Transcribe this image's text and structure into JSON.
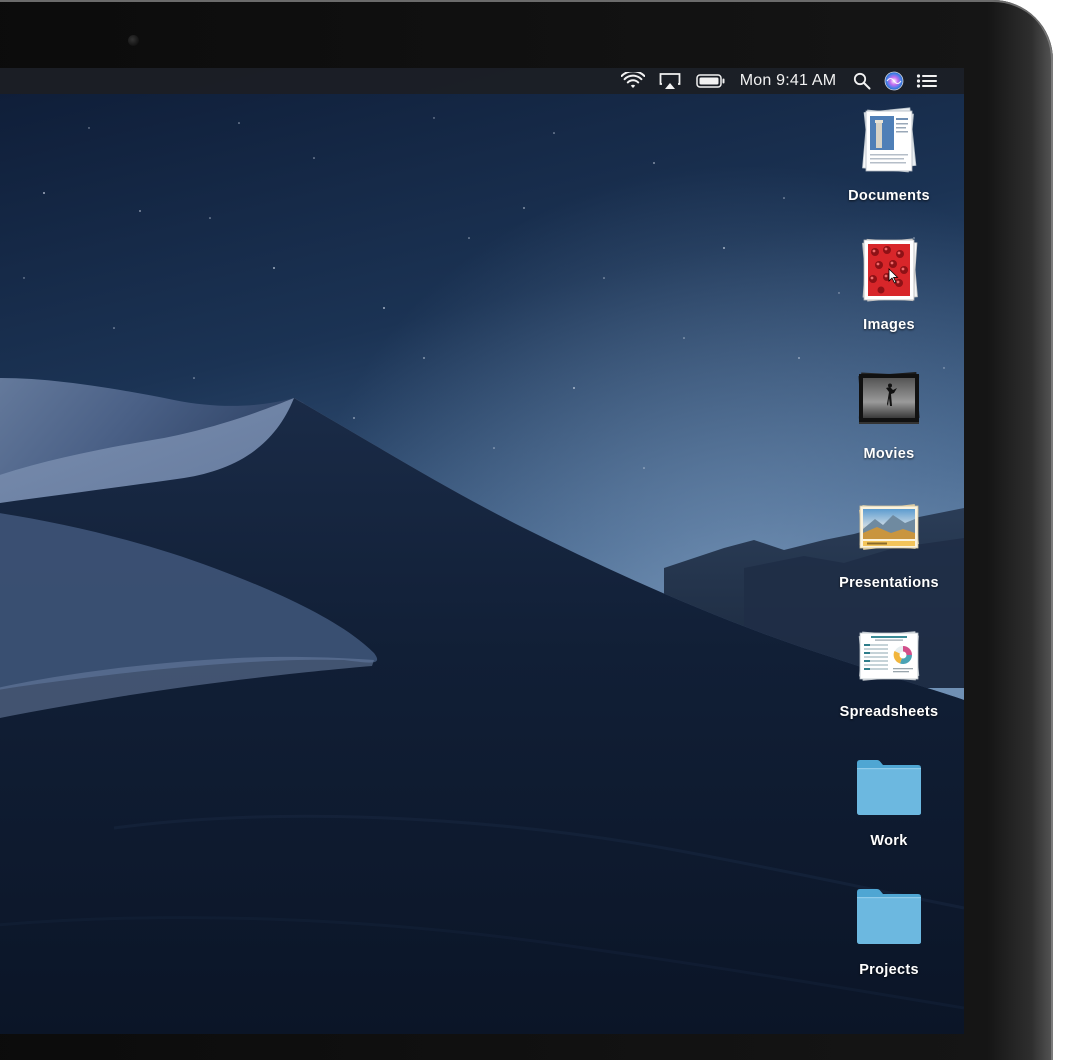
{
  "menubar": {
    "clock": "Mon 9:41 AM",
    "icons": [
      "wifi-icon",
      "airplay-icon",
      "battery-icon",
      "spotlight-search-icon",
      "siri-icon",
      "notification-center-icon"
    ]
  },
  "desktop": {
    "wallpaper": "Mojave dunes at night",
    "stacks": [
      {
        "label": "Documents",
        "icon": "documents-stack-icon"
      },
      {
        "label": "Images",
        "icon": "images-stack-icon"
      },
      {
        "label": "Movies",
        "icon": "movies-stack-icon"
      },
      {
        "label": "Presentations",
        "icon": "presentations-stack-icon"
      },
      {
        "label": "Spreadsheets",
        "icon": "spreadsheets-stack-icon"
      },
      {
        "label": "Work",
        "icon": "folder-icon"
      },
      {
        "label": "Projects",
        "icon": "folder-icon"
      }
    ]
  },
  "colors": {
    "menubar": "#1c1e24",
    "folder": "#6cb8e0",
    "sky_top": "#0f1e38",
    "sky_horizon": "#5a7ea3",
    "dune_dark": "#0e1a2f",
    "bezel": "#0b0b0b"
  }
}
